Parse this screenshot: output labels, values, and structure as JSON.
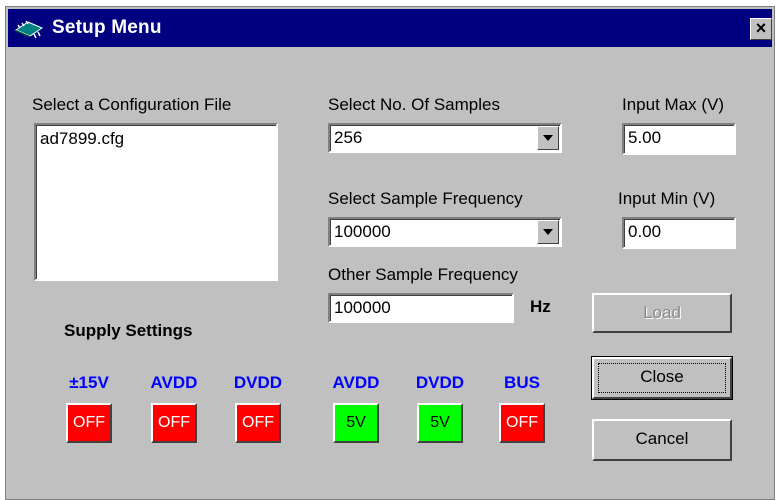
{
  "window": {
    "title": "Setup Menu",
    "close_label": "×"
  },
  "config": {
    "label": "Select a Configuration File",
    "files": [
      "ad7899.cfg"
    ]
  },
  "samples": {
    "label": "Select No. Of Samples",
    "value": "256"
  },
  "sample_frequency": {
    "label": "Select Sample Frequency",
    "value": "100000"
  },
  "other_frequency": {
    "label": "Other Sample Frequency",
    "value": "100000",
    "unit": "Hz"
  },
  "input_max": {
    "label": "Input Max (V)",
    "value": "5.00"
  },
  "input_min": {
    "label": "Input Min (V)",
    "value": "0.00"
  },
  "buttons": {
    "load": "Load",
    "close": "Close",
    "cancel": "Cancel"
  },
  "supply": {
    "title": "Supply Settings",
    "items": [
      {
        "label": "±15V",
        "state": "OFF",
        "color": "#ff0000"
      },
      {
        "label": "AVDD",
        "state": "OFF",
        "color": "#ff0000"
      },
      {
        "label": "DVDD",
        "state": "OFF",
        "color": "#ff0000"
      },
      {
        "label": "AVDD",
        "state": "5V",
        "color": "#00ff00"
      },
      {
        "label": "DVDD",
        "state": "5V",
        "color": "#00ff00"
      },
      {
        "label": "BUS",
        "state": "OFF",
        "color": "#ff0000"
      }
    ]
  },
  "colors": {
    "title_bar": "#000080",
    "dialog_bg": "#c0c0c0",
    "supply_label": "#0000ff"
  }
}
